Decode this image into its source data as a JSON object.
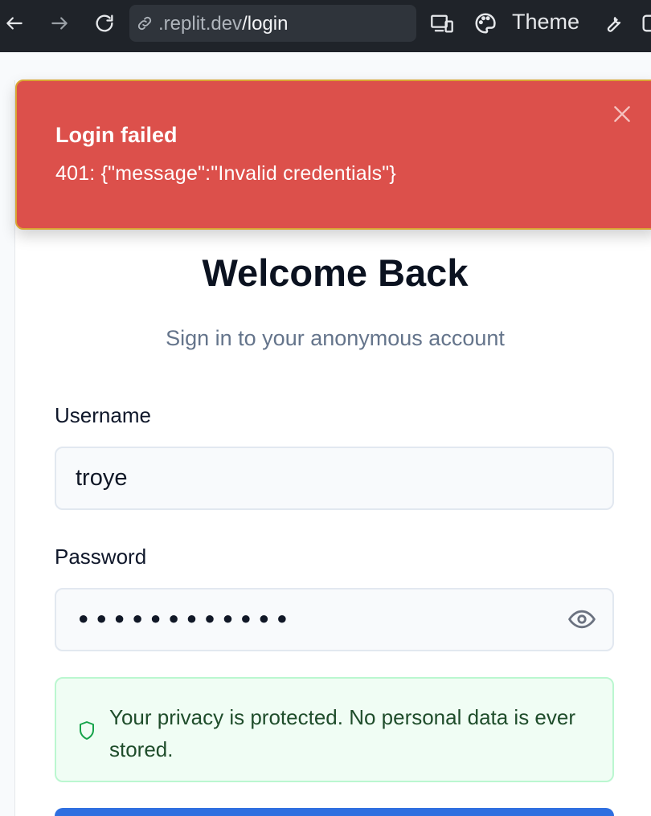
{
  "browser": {
    "url_prefix": ".replit.dev",
    "url_path": "/login",
    "theme_label": "Theme"
  },
  "toast": {
    "title": "Login failed",
    "message": "401: {\"message\":\"Invalid credentials\"}"
  },
  "login": {
    "heading": "Welcome Back",
    "subheading": "Sign in to your anonymous account",
    "username_label": "Username",
    "username_value": "troye",
    "password_label": "Password",
    "password_masked": "••••••••••••",
    "privacy_notice": "Your privacy is protected. No personal data is ever stored."
  },
  "colors": {
    "toast_bg": "#dc504b",
    "accent": "#2f6fe0",
    "notice_bg": "#f0fdf4"
  }
}
